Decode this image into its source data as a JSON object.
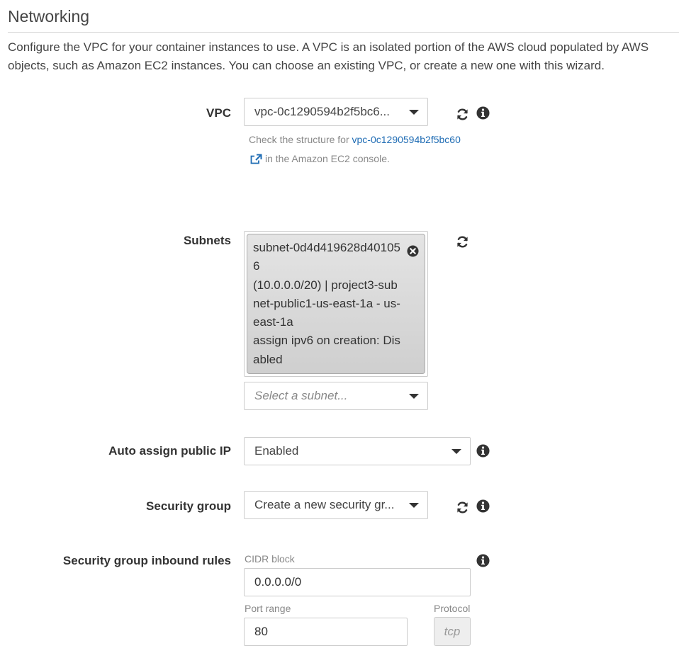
{
  "section": {
    "title": "Networking",
    "description": "Configure the VPC for your container instances to use. A VPC is an isolated portion of the AWS cloud populated by AWS objects, such as Amazon EC2 instances. You can choose an existing VPC, or create a new one with this wizard."
  },
  "vpc": {
    "label": "VPC",
    "value": "vpc-0c1290594b2f5bc6...",
    "help_prefix": "Check the structure for",
    "help_link": "vpc-0c1290594b2f5bc60",
    "help_suffix": "in the Amazon EC2 console.",
    "icons": [
      "refresh-icon",
      "info-icon",
      "external-link-icon",
      "chevron-down-icon"
    ]
  },
  "subnets": {
    "label": "Subnets",
    "selected": [
      {
        "line1": "subnet-0d4d419628d401056",
        "line2": "(10.0.0.0/20) | project3-subnet-public1-us-east-1a - us-east-1a",
        "line3": "assign ipv6 on creation: Disabled"
      }
    ],
    "placeholder": "Select a subnet...",
    "icons": [
      "refresh-icon",
      "close-icon"
    ]
  },
  "auto_assign_ip": {
    "label": "Auto assign public IP",
    "value": "Enabled"
  },
  "security_group": {
    "label": "Security group",
    "value": "Create a new security gr..."
  },
  "inbound_rules": {
    "label": "Security group inbound rules",
    "cidr_label": "CIDR block",
    "cidr_value": "0.0.0.0/0",
    "port_label": "Port range",
    "port_value": "80",
    "protocol_label": "Protocol",
    "protocol_value": "tcp"
  },
  "colors": {
    "link": "#1f6cb4",
    "text": "#444444",
    "chip_bg": "#d9d9d9",
    "icon": "#333333"
  }
}
